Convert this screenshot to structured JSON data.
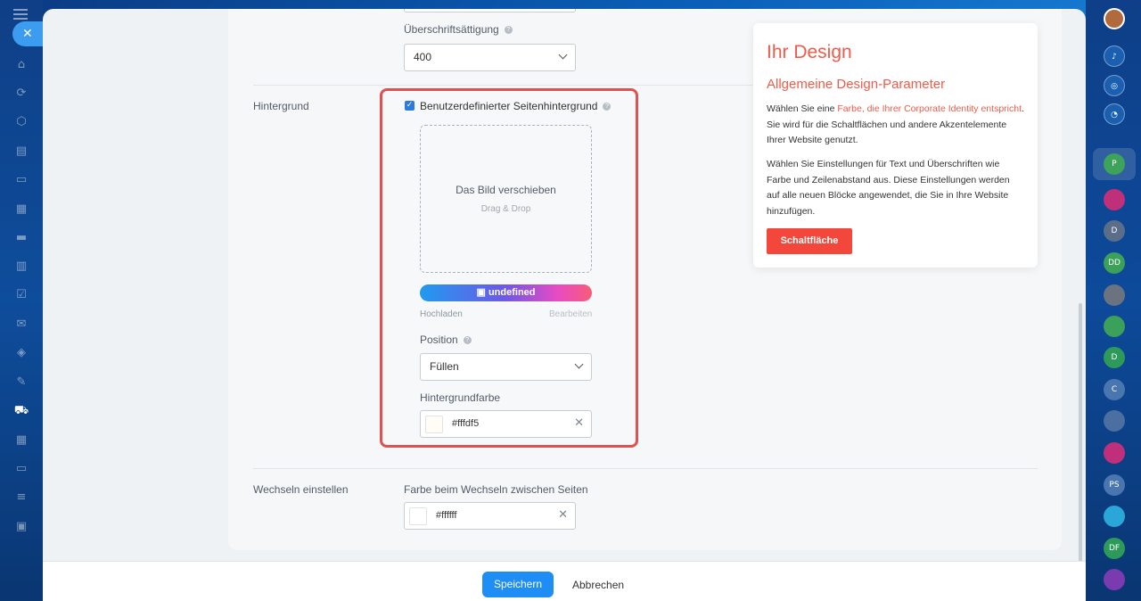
{
  "left_nav": {
    "icons": [
      "menu-icon",
      "home-icon",
      "sync-icon",
      "hexagon-icon",
      "document-icon",
      "chat-icon",
      "calendar-icon",
      "card-icon",
      "board-icon",
      "checklist-icon",
      "mail-icon",
      "settings-icon",
      "sign-icon",
      "cart-icon",
      "grid-icon",
      "tag-icon",
      "filter-icon",
      "box-icon"
    ],
    "close_symbol": "✕"
  },
  "right_bar": {
    "avatars": [
      {
        "label": "",
        "color": "#b06a3b"
      },
      {
        "label": "",
        "color": "#1a5fb0",
        "icon": "bell-icon"
      },
      {
        "label": "",
        "color": "#1a5fb0",
        "icon": "spiral-icon"
      },
      {
        "label": "",
        "color": "#1a5fb0",
        "icon": "chat-icon"
      },
      {
        "label": "P",
        "color": "#3ea35a"
      },
      {
        "label": "",
        "color": "#c0307a"
      },
      {
        "label": "D",
        "color": "#5a6e8a"
      },
      {
        "label": "DD",
        "color": "#3aa05a"
      },
      {
        "label": "",
        "color": "#6b7280"
      },
      {
        "label": "",
        "color": "#3aa05a"
      },
      {
        "label": "D",
        "color": "#2e9a5a"
      },
      {
        "label": "C",
        "color": "#4a76b0"
      },
      {
        "label": "",
        "color": "#4a6fa0"
      },
      {
        "label": "",
        "color": "#c0307a"
      },
      {
        "label": "PS",
        "color": "#4a76b0"
      },
      {
        "label": "",
        "color": "#2aa7d8"
      },
      {
        "label": "DF",
        "color": "#2e9a5a"
      },
      {
        "label": "",
        "color": "#7a3bb0"
      }
    ]
  },
  "form": {
    "heading_saturation_label": "Überschriftsättigung",
    "heading_saturation_value": "400",
    "background_section_label": "Hintergrund",
    "custom_background_label": "Benutzerdefinierter Seitenhintergrund",
    "dropzone_title": "Das Bild verschieben",
    "dropzone_sub": "Drag & Drop",
    "ai_button_label": "undefined",
    "upload_label": "Hochladen",
    "edit_label": "Bearbeiten",
    "position_label": "Position",
    "position_value": "Füllen",
    "bg_color_label": "Hintergrundfarbe",
    "bg_color_value": "#fffdf5",
    "switch_section_label": "Wechseln einstellen",
    "switch_color_label": "Farbe beim Wechseln zwischen Seiten",
    "switch_color_value": "#ffffff"
  },
  "info_card": {
    "title": "Ihr Design",
    "subtitle": "Allgemeine Design-Parameter",
    "p1_prefix": "Wählen Sie eine ",
    "p1_link": "Farbe, die Ihrer Corporate Identity entspricht",
    "p1_suffix": ". Sie wird für die Schaltflächen und andere Akzentelemente Ihrer Website genutzt.",
    "p2": "Wählen Sie Einstellungen für Text und Überschriften wie Farbe und Zeilenabstand aus. Diese Einstellungen werden auf alle neuen Blöcke angewendet, die Sie in Ihre Website hinzufügen.",
    "button_label": "Schaltfläche",
    "accent_color": "#f05b4a"
  },
  "footer": {
    "save_label": "Speichern",
    "cancel_label": "Abbrechen"
  }
}
